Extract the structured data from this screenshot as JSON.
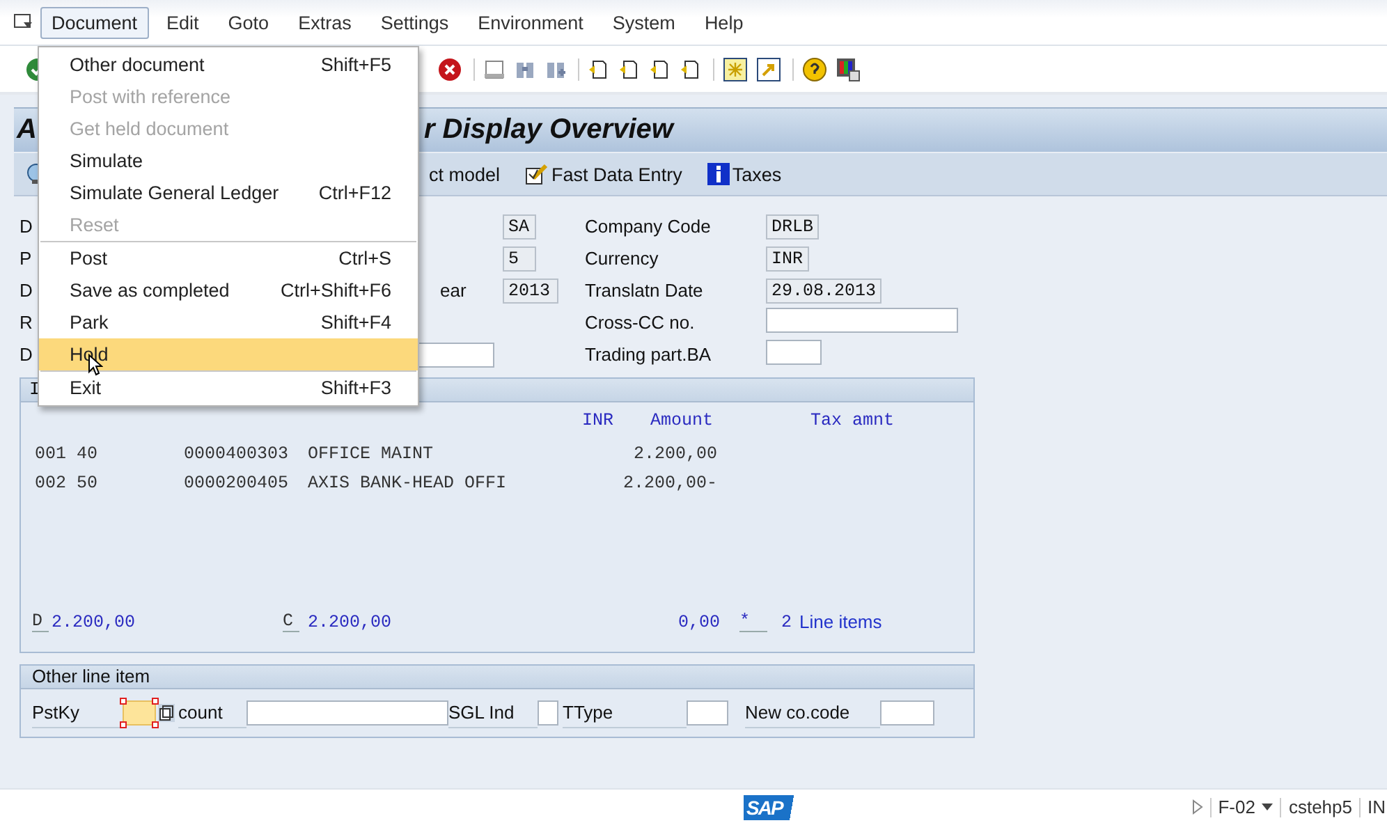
{
  "menubar": {
    "items": [
      {
        "label": "Document",
        "selected": true
      },
      {
        "label": "Edit",
        "selected": false
      },
      {
        "label": "Goto",
        "selected": false
      },
      {
        "label": "Extras",
        "selected": false
      },
      {
        "label": "Settings",
        "selected": false
      },
      {
        "label": "Environment",
        "selected": false
      },
      {
        "label": "System",
        "selected": false
      },
      {
        "label": "Help",
        "selected": false
      }
    ]
  },
  "title": {
    "left_part": "A",
    "right_part": "r Display Overview"
  },
  "app_toolbar": {
    "buttons": [
      {
        "label": "ct model",
        "kind": "plain"
      },
      {
        "label": "Fast Data Entry",
        "kind": "fast"
      },
      {
        "label": "Taxes",
        "kind": "info"
      }
    ]
  },
  "header": {
    "rows": [
      {
        "label": "D",
        "mid_field": {
          "kind": "display",
          "value": "SA"
        },
        "right_label": "Company Code",
        "right_field": {
          "kind": "display",
          "value": "DRLB"
        }
      },
      {
        "label": "P",
        "mid_field": {
          "kind": "display",
          "value": "5"
        },
        "right_label": "Currency",
        "right_field": {
          "kind": "display",
          "value": "INR"
        }
      },
      {
        "label": "D",
        "mid_label": "ear",
        "mid_field": {
          "kind": "display",
          "value": "2013"
        },
        "right_label": "Translatn Date",
        "right_field": {
          "kind": "display",
          "value": "29.08.2013"
        }
      },
      {
        "label": "R",
        "right_label": "Cross-CC no.",
        "right_field": {
          "kind": "input"
        }
      },
      {
        "label": "D",
        "mid_field": {
          "kind": "input"
        },
        "right_label": "Trading part.BA",
        "right_field": {
          "kind": "input"
        }
      }
    ]
  },
  "items": {
    "title": "I",
    "columns": [
      "INR",
      "Amount",
      "Tax amnt"
    ],
    "rows": [
      {
        "item": "001",
        "posting_key": "40",
        "account": "0000400303",
        "text": "OFFICE MAINT",
        "amount": "2.200,00"
      },
      {
        "item": "002",
        "posting_key": "50",
        "account": "0000200405",
        "text": "AXIS BANK-HEAD OFFI",
        "amount": "2.200,00-"
      }
    ],
    "totals": {
      "debit_label": "D",
      "debit": "2.200,00",
      "credit_label": "C",
      "credit": "2.200,00",
      "balance": "0,00",
      "balance_flag": "*",
      "count": "2",
      "count_label": "Line items"
    }
  },
  "other_line_item": {
    "title": "Other line item",
    "fields": [
      {
        "label": "PstKy",
        "kind": "selected_key"
      },
      {
        "label": "count",
        "kind": "icon_label"
      },
      {
        "label": "SGL Ind",
        "kind": "tiny"
      },
      {
        "label": "TType",
        "kind": "small"
      },
      {
        "label": "New co.code",
        "kind": "small"
      }
    ]
  },
  "status_bar": {
    "logo": "SAP",
    "transaction": "F-02",
    "server": "cstehp5",
    "mode": "IN"
  },
  "menu": {
    "items": [
      {
        "kind": "item",
        "label": "Other document",
        "shortcut": "Shift+F5",
        "disabled": false,
        "selected": false
      },
      {
        "kind": "item",
        "label": "Post with reference",
        "disabled": true,
        "selected": false
      },
      {
        "kind": "item",
        "label": "Get held document",
        "disabled": true,
        "selected": false
      },
      {
        "kind": "item",
        "label": "Simulate",
        "disabled": false,
        "selected": false
      },
      {
        "kind": "item",
        "label": "Simulate General Ledger",
        "shortcut": "Ctrl+F12",
        "disabled": false,
        "selected": false
      },
      {
        "kind": "item",
        "label": "Reset",
        "disabled": true,
        "selected": false
      },
      {
        "kind": "separator"
      },
      {
        "kind": "item",
        "label": "Post",
        "shortcut": "Ctrl+S",
        "disabled": false,
        "selected": false
      },
      {
        "kind": "item",
        "label": "Save as completed",
        "shortcut": "Ctrl+Shift+F6",
        "disabled": false,
        "selected": false
      },
      {
        "kind": "item",
        "label": "Park",
        "shortcut": "Shift+F4",
        "disabled": false,
        "selected": false
      },
      {
        "kind": "item",
        "label": "Hold",
        "disabled": false,
        "selected": true
      },
      {
        "kind": "separator"
      },
      {
        "kind": "item",
        "label": "Exit",
        "shortcut": "Shift+F3",
        "disabled": false,
        "selected": false
      }
    ]
  }
}
